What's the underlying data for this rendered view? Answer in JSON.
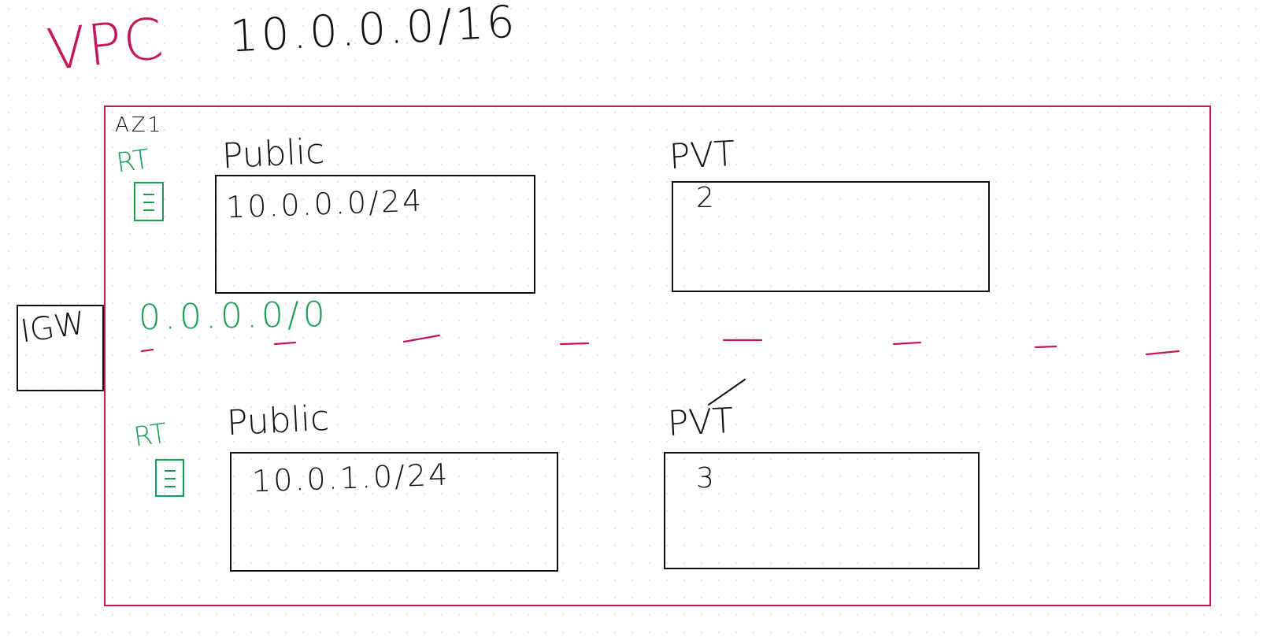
{
  "vpc": {
    "label": "VPC",
    "cidr": "10.0.0.0/16",
    "border_color": "#c2185b"
  },
  "igw": {
    "label": "IGW"
  },
  "az": {
    "label": "AZ1"
  },
  "route_tables": [
    {
      "label": "RT",
      "icon": "route-table-icon",
      "color": "#1a9e55"
    },
    {
      "label": "RT",
      "icon": "route-table-icon",
      "color": "#1a9e55"
    }
  ],
  "default_route": {
    "cidr": "0.0.0.0/0",
    "color": "#1a9e55"
  },
  "subnets": [
    {
      "title": "Public",
      "cidr": "10.0.0.0/24"
    },
    {
      "title": "PVT",
      "cidr": "2"
    },
    {
      "title": "Public",
      "cidr": "10.0.1.0/24"
    },
    {
      "title": "PVT",
      "cidr": "3"
    }
  ]
}
